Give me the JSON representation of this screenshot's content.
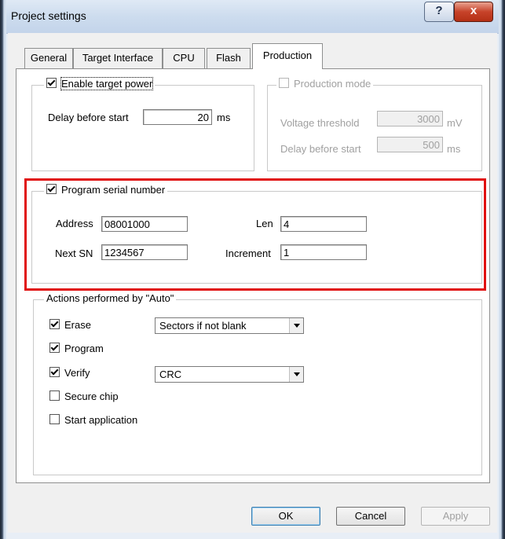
{
  "window": {
    "title": "Project settings",
    "help_glyph": "?",
    "close_glyph": "x"
  },
  "tabs": [
    {
      "label": "General"
    },
    {
      "label": "Target Interface"
    },
    {
      "label": "CPU"
    },
    {
      "label": "Flash"
    },
    {
      "label": "Production",
      "active": true
    }
  ],
  "target_power": {
    "checkbox_label": "Enable target power",
    "checked": true,
    "delay_label": "Delay before start",
    "delay_value": "20",
    "delay_unit": "ms"
  },
  "production_mode": {
    "checkbox_label": "Production mode",
    "checked": false,
    "enabled": false,
    "voltage_label": "Voltage threshold",
    "voltage_value": "3000",
    "voltage_unit": "mV",
    "delay_label": "Delay before start",
    "delay_value": "500",
    "delay_unit": "ms"
  },
  "serial_number": {
    "checkbox_label": "Program serial number",
    "checked": true,
    "address_label": "Address",
    "address_value": "08001000",
    "len_label": "Len",
    "len_value": "4",
    "next_sn_label": "Next SN",
    "next_sn_value": "1234567",
    "increment_label": "Increment",
    "increment_value": "1"
  },
  "auto_actions": {
    "group_title": "Actions performed by \"Auto\"",
    "items": [
      {
        "label": "Erase",
        "checked": true,
        "select": "Sectors if not blank"
      },
      {
        "label": "Program",
        "checked": true
      },
      {
        "label": "Verify",
        "checked": true,
        "select": "CRC"
      },
      {
        "label": "Secure chip",
        "checked": false
      },
      {
        "label": "Start application",
        "checked": false
      }
    ]
  },
  "buttons": {
    "ok": "OK",
    "cancel": "Cancel",
    "apply": "Apply"
  },
  "colors": {
    "highlight": "#e01010",
    "close_button": "#c7432a",
    "default_button_border": "#3c7fb1"
  }
}
